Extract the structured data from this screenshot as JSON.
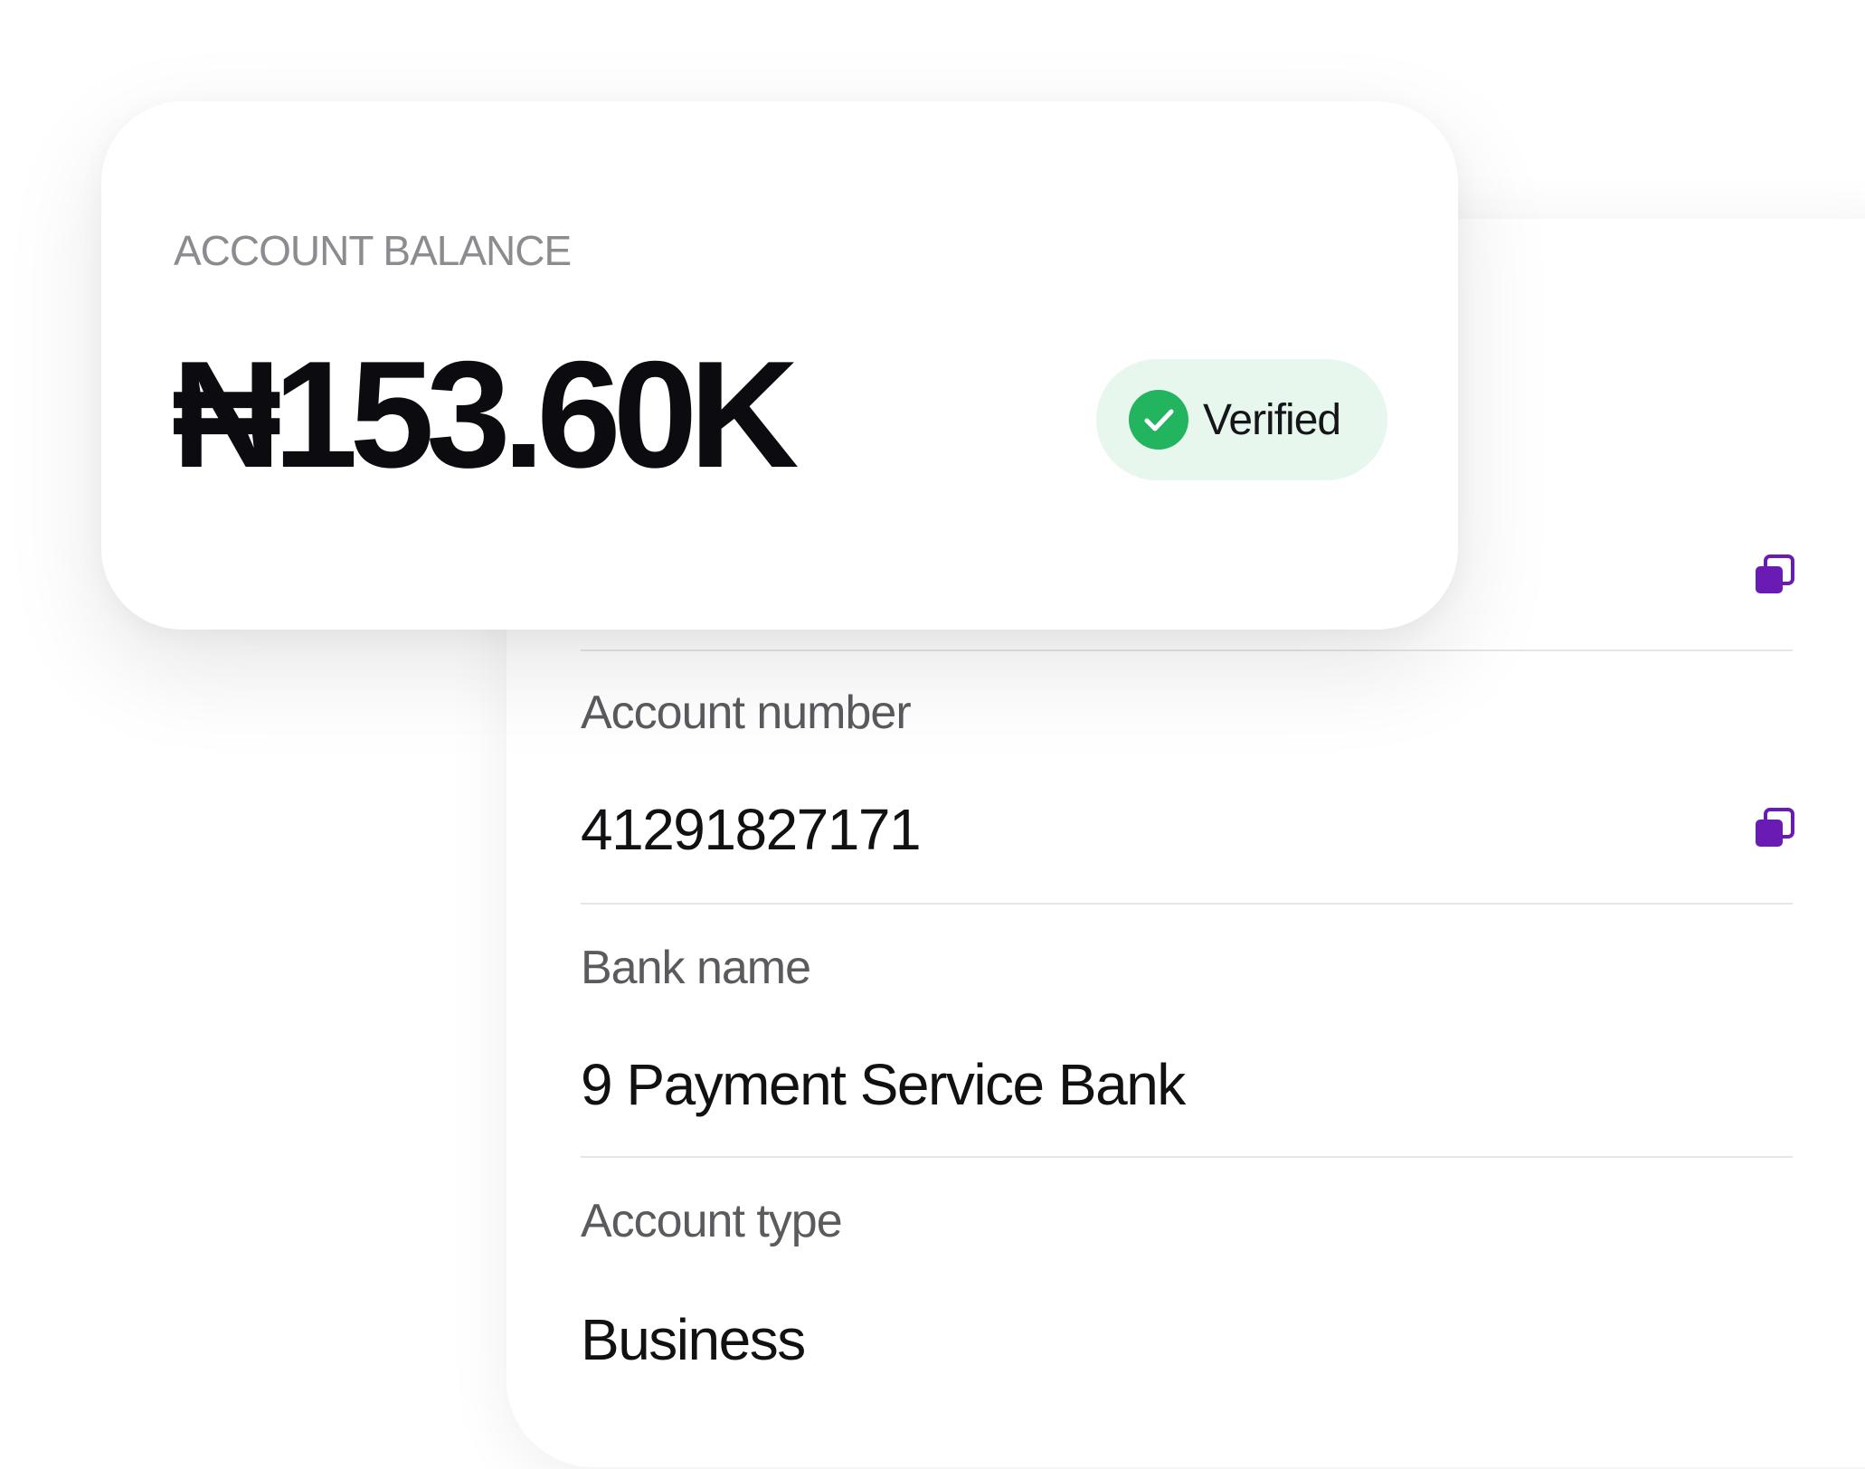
{
  "balance": {
    "label": "ACCOUNT BALANCE",
    "amount": "₦153.60K",
    "status": "Verified",
    "status_icon": "check-circle-icon",
    "status_color": "#22b45f"
  },
  "details": {
    "account_number_label": "Account number",
    "account_number": "41291827171",
    "bank_name_label": "Bank name",
    "bank_name": "9 Payment Service Bank",
    "account_type_label": "Account type",
    "account_type": "Business",
    "copy_icon": "copy-icon",
    "accent_color": "#6a1bb4"
  }
}
